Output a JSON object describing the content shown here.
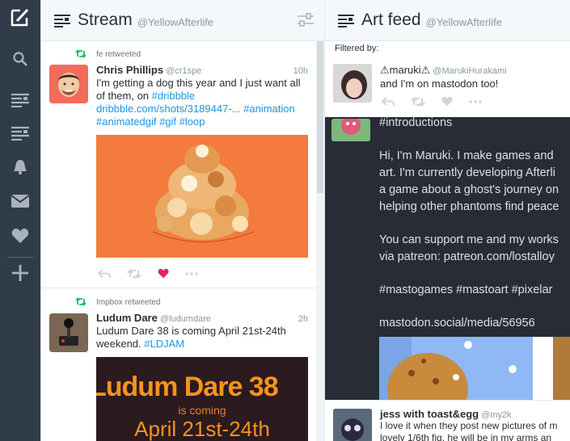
{
  "colors": {
    "sidebar": "#313c4a",
    "accent": "#1b95e0",
    "retweet": "#17bf63",
    "like": "#e0245e",
    "dark_toot": "#282c37"
  },
  "sidebar": {
    "items": [
      {
        "icon": "compose-icon"
      },
      {
        "icon": "search-icon"
      },
      {
        "icon": "column-icon"
      },
      {
        "icon": "column-icon"
      },
      {
        "icon": "bell-icon"
      },
      {
        "icon": "envelope-icon"
      },
      {
        "icon": "heart-icon"
      },
      {
        "icon": "plus-icon"
      }
    ]
  },
  "columns": {
    "stream": {
      "title": "Stream",
      "handle": "@YellowAfterlife",
      "tweets": [
        {
          "retweeted_by": "fe retweeted",
          "name": "Chris Phillips",
          "handle": "@cr1spe",
          "time": "10h",
          "text": "I'm getting a dog this year and I just want all of them, on",
          "link1": "#dribbble",
          "link2": "dribbble.com/shots/3189447-...",
          "link3": "#animation",
          "link4": "#animatedgif",
          "link5": "#gif",
          "link6": "#loop",
          "liked": true
        },
        {
          "retweeted_by": "Impbox retweeted",
          "name": "Ludum Dare",
          "handle": "@ludumdare",
          "time": "2h",
          "text": "Ludum Dare 38 is coming April 21st-24th weekend.",
          "link1": "#LDJAM",
          "media_title": "Ludum Dare 38",
          "media_sub": "is coming",
          "media_date": "April 21st-24th"
        }
      ]
    },
    "art_feed": {
      "title": "Art feed",
      "handle": "@YellowAfterlife",
      "filtered_label": "Filtered by:",
      "toot": {
        "name": "⚠maruki⚠",
        "handle": "@MarukiHurakami",
        "text": "and I'm on mastodon too!",
        "lines": [
          "#introductions",
          "",
          "Hi, I'm Maruki. I make games and",
          "art. I'm currently developing Afterli",
          "a game about a ghost's journey on",
          "helping other phantoms find peace",
          "",
          "You can support me and my works",
          "via patreon: patreon.com/lostalloy",
          "",
          "#mastogames #mastoart #pixelar",
          "",
          "mastodon.social/media/56956"
        ]
      },
      "next": {
        "name": "jess with toast&egg",
        "handle": "@my2k",
        "line1": "I love it when they post new pictures of m",
        "line2": "lovely 1/6th fig. he will be in my arms an"
      }
    }
  }
}
